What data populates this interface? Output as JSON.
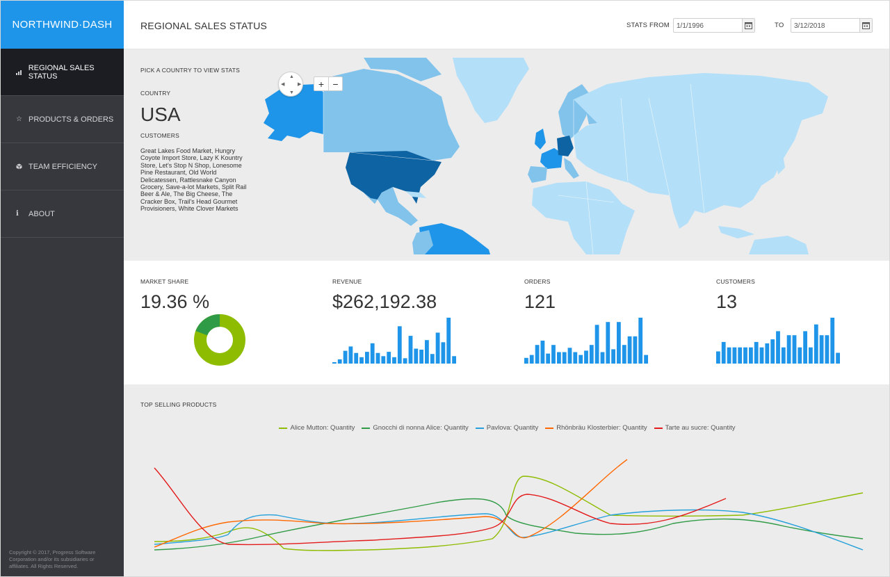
{
  "app": {
    "brand": "NORTHWIND·DASH",
    "copyright": "Copyright © 2017, Progress Software Corporation and/or its subsidiaries or affiliates. All Rights Reserved."
  },
  "sidebar": {
    "items": [
      {
        "label": "REGIONAL SALES STATUS",
        "icon": "bar-chart-icon",
        "active": true
      },
      {
        "label": "PRODUCTS & ORDERS",
        "icon": "star-icon",
        "active": false
      },
      {
        "label": "TEAM EFFICIENCY",
        "icon": "cube-icon",
        "active": false
      },
      {
        "label": "ABOUT",
        "icon": "info-icon",
        "active": false
      }
    ]
  },
  "header": {
    "title": "REGIONAL SALES STATUS",
    "stats_from_label": "STATS FROM",
    "from_date": "1/1/1996",
    "to_label": "TO",
    "to_date": "3/12/2018"
  },
  "map": {
    "prompt": "PICK A COUNTRY TO VIEW STATS",
    "country_label": "COUNTRY",
    "country": "USA",
    "customers_label": "CUSTOMERS",
    "customers": "Great Lakes Food Market, Hungry Coyote Import Store, Lazy K Kountry Store, Let's Stop N Shop, Lonesome Pine Restaurant, Old World Delicatessen, Rattlesnake Canyon Grocery, Save-a-lot Markets, Split Rail Beer & Ale, The Big Cheese, The Cracker Box, Trail's Head Gourmet Provisioners, White Clover Markets",
    "zoom_in": "+",
    "zoom_out": "−"
  },
  "kpis": {
    "market_share": {
      "label": "MARKET SHARE",
      "value": "19.36 %",
      "share": 0.1936
    },
    "revenue": {
      "label": "REVENUE",
      "value": "$262,192.38",
      "bars": [
        2,
        8,
        24,
        32,
        20,
        12,
        22,
        38,
        20,
        14,
        22,
        12,
        70,
        10,
        52,
        28,
        26,
        44,
        18,
        58,
        40,
        86,
        14
      ]
    },
    "orders": {
      "label": "ORDERS",
      "value": "121",
      "bars": [
        8,
        12,
        26,
        32,
        14,
        26,
        16,
        16,
        22,
        16,
        12,
        18,
        26,
        54,
        16,
        58,
        20,
        58,
        26,
        38,
        38,
        64,
        12
      ]
    },
    "customers": {
      "label": "CUSTOMERS",
      "value": "13",
      "bars": [
        18,
        32,
        24,
        24,
        24,
        24,
        24,
        32,
        24,
        30,
        36,
        48,
        24,
        42,
        42,
        24,
        48,
        24,
        58,
        42,
        42,
        68,
        16
      ]
    }
  },
  "top_products": {
    "title": "TOP SELLING PRODUCTS",
    "series": [
      {
        "name": "Alice Mutton: Quantity",
        "color": "#8ebc00"
      },
      {
        "name": "Gnocchi di nonna Alice: Quantity",
        "color": "#309b46"
      },
      {
        "name": "Pavlova: Quantity",
        "color": "#25a0da"
      },
      {
        "name": "Rhönbräu Klosterbier: Quantity",
        "color": "#ff6800"
      },
      {
        "name": "Tarte au sucre: Quantity",
        "color": "#e31b1b"
      }
    ]
  },
  "colors": {
    "accent": "#1e95e8",
    "sidebar": "#37383d",
    "sidebar_active": "#1c1d22",
    "bar": "#1e95e8",
    "donut_share": "#309b46",
    "donut_rest": "#8ebc00"
  }
}
